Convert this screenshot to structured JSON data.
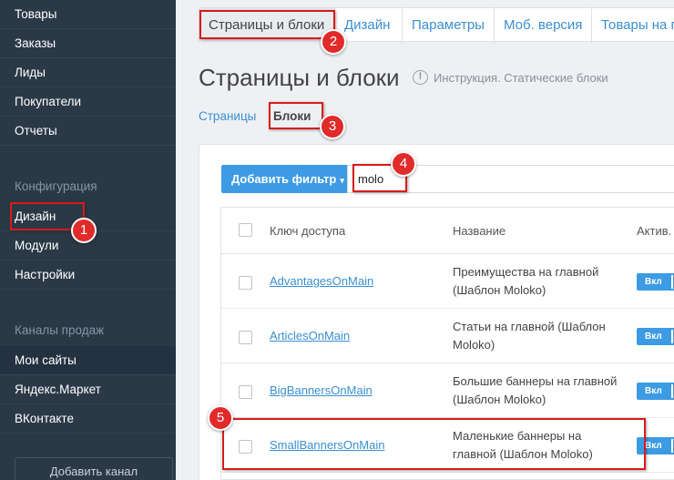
{
  "sidebar": {
    "items_top": [
      "Товары",
      "Заказы",
      "Лиды",
      "Покупатели",
      "Отчеты"
    ],
    "config_header": "Конфигурация",
    "config_items": [
      "Дизайн",
      "Модули",
      "Настройки"
    ],
    "channels_header": "Каналы продаж",
    "channel_items": [
      "Мои сайты",
      "Яндекс.Маркет",
      "ВКонтакте"
    ],
    "add_channel": "Добавить канал"
  },
  "tabs": [
    "Страницы и блоки",
    "Дизайн",
    "Параметры",
    "Моб. версия",
    "Товары на г"
  ],
  "page": {
    "title": "Страницы и блоки",
    "help_icon_glyph": "!",
    "help_link": "Инструкция. Статические блоки",
    "subnav": [
      "Страницы",
      "Блоки"
    ]
  },
  "filter": {
    "button_label": "Добавить фильтр",
    "caret": "▾",
    "search_value": "molo"
  },
  "table": {
    "headers": [
      "Ключ доступа",
      "Название",
      "Актив."
    ],
    "rows": [
      {
        "key": "AdvantagesOnMain",
        "name": "Преимущества на главной (Шаблон Moloko)",
        "status": "Вкл"
      },
      {
        "key": "ArticlesOnMain",
        "name": "Статьи на главной (Шаблон Moloko)",
        "status": "Вкл"
      },
      {
        "key": "BigBannersOnMain",
        "name": "Большие баннеры на главной (Шаблон Moloko)",
        "status": "Вкл"
      },
      {
        "key": "SmallBannersOnMain",
        "name": "Маленькие баннеры на главной (Шаблон Moloko)",
        "status": "Вкл"
      }
    ]
  },
  "annotations": [
    "1",
    "2",
    "3",
    "4",
    "5"
  ],
  "colors": {
    "sidebar_bg": "#2b3947",
    "accent_blue": "#3d9be3",
    "link_blue": "#3a8fd1",
    "annotation_red": "#d81b1b"
  }
}
